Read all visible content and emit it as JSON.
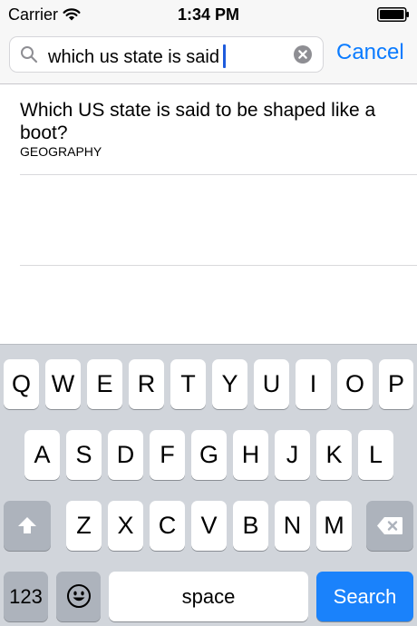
{
  "status_bar": {
    "carrier": "Carrier",
    "time": "1:34 PM",
    "icons": [
      "wifi-icon",
      "battery-icon"
    ]
  },
  "search": {
    "query": "which us state is said",
    "cancel_label": "Cancel",
    "icons": [
      "search-icon",
      "clear-icon"
    ],
    "caret_color": "#1e5bdc",
    "accent_color": "#0a7bff"
  },
  "results": [
    {
      "question": "Which US state is said to be shaped like a boot?",
      "category": "GEOGRAPHY"
    }
  ],
  "keyboard": {
    "row1": [
      "Q",
      "W",
      "E",
      "R",
      "T",
      "Y",
      "U",
      "I",
      "O",
      "P"
    ],
    "row2": [
      "A",
      "S",
      "D",
      "F",
      "G",
      "H",
      "J",
      "K",
      "L"
    ],
    "row3": [
      "Z",
      "X",
      "C",
      "V",
      "B",
      "N",
      "M"
    ],
    "numbers_label": "123",
    "space_label": "space",
    "search_label": "Search",
    "icons": [
      "shift-icon",
      "delete-icon",
      "emoji-icon"
    ],
    "search_key_color": "#1a82fb"
  }
}
